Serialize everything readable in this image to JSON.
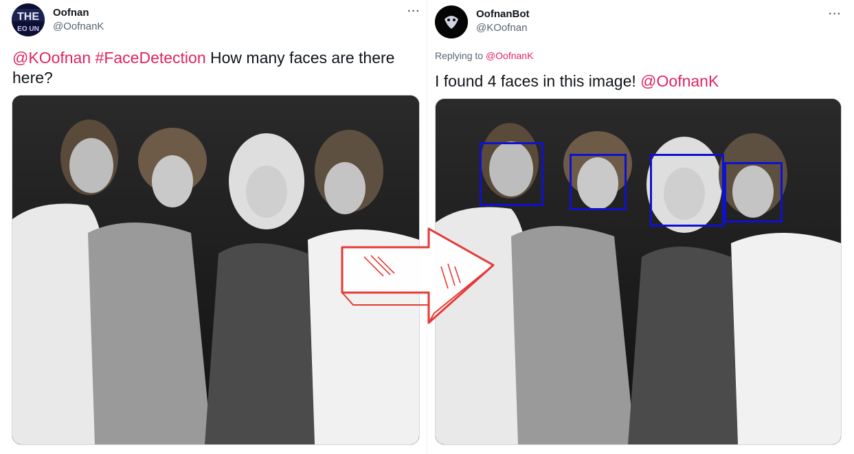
{
  "left_tweet": {
    "author_name": "Oofnan",
    "author_handle": "@OofnanK",
    "avatar_text": "THE\nEO UN",
    "more_label": "···",
    "text_mention": "@KOofnan",
    "text_hashtag": "#FaceDetection",
    "text_body": " How many faces are there here?"
  },
  "right_tweet": {
    "author_name": "OofnanBot",
    "author_handle": "@KOofnan",
    "more_label": "···",
    "replying_prefix": "Replying to ",
    "replying_handle": "@OofnanK",
    "text_body": "I found 4 faces in this image! ",
    "text_mention": "@OofnanK"
  },
  "colors": {
    "mention": "#e0245e",
    "face_box": "#1010d0",
    "arrow": "#e53935"
  },
  "icons": [
    "more-icon",
    "arrow-icon"
  ]
}
